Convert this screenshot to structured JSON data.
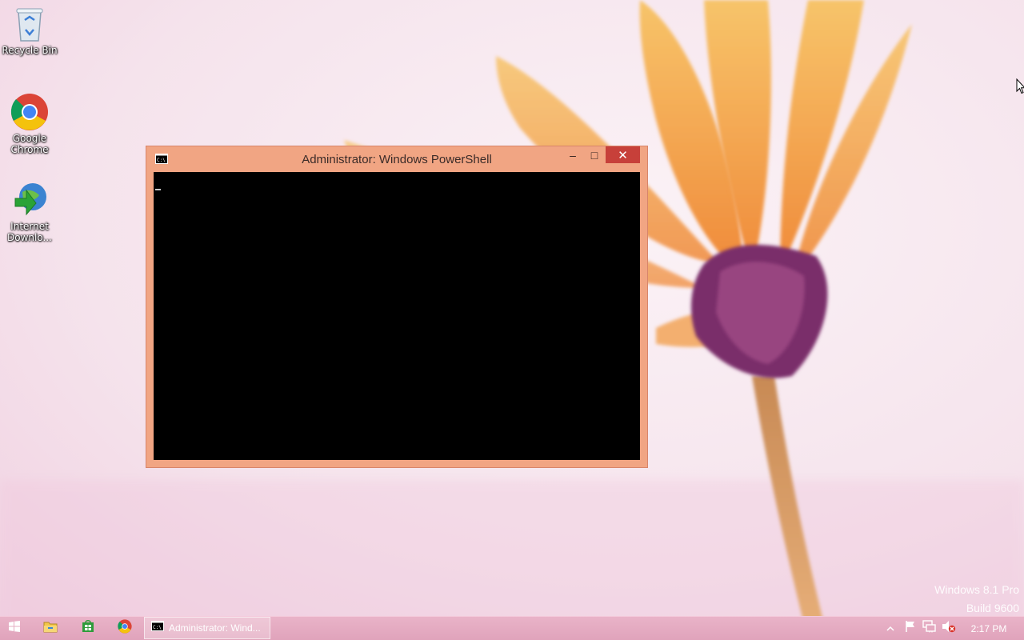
{
  "desktop": {
    "icons": [
      {
        "label": "Recycle Bin",
        "icon": "recycle-bin-icon"
      },
      {
        "label": "Google Chrome",
        "icon": "chrome-icon"
      },
      {
        "label": "Internet Downlo...",
        "icon": "internet-download-manager-icon"
      }
    ],
    "watermark": {
      "line1": "Windows 8.1 Pro",
      "line2": "Build 9600"
    }
  },
  "window": {
    "title": "Administrator: Windows PowerShell",
    "icon": "powershell-console-icon",
    "controls": {
      "minimize": "–",
      "maximize": "□",
      "close": "✕"
    },
    "accent_color": "#f1a583",
    "console_background": "#000000"
  },
  "taskbar": {
    "pinned": [
      "windows-start-icon",
      "file-explorer-icon",
      "store-icon",
      "chrome-icon"
    ],
    "active_task_label": "Administrator: Wind...",
    "tray_icons": [
      "show-hidden-icons",
      "action-center-flag-icon",
      "network-icon",
      "volume-muted-icon"
    ],
    "clock": "2:17 PM",
    "color": "#e6acc3"
  }
}
